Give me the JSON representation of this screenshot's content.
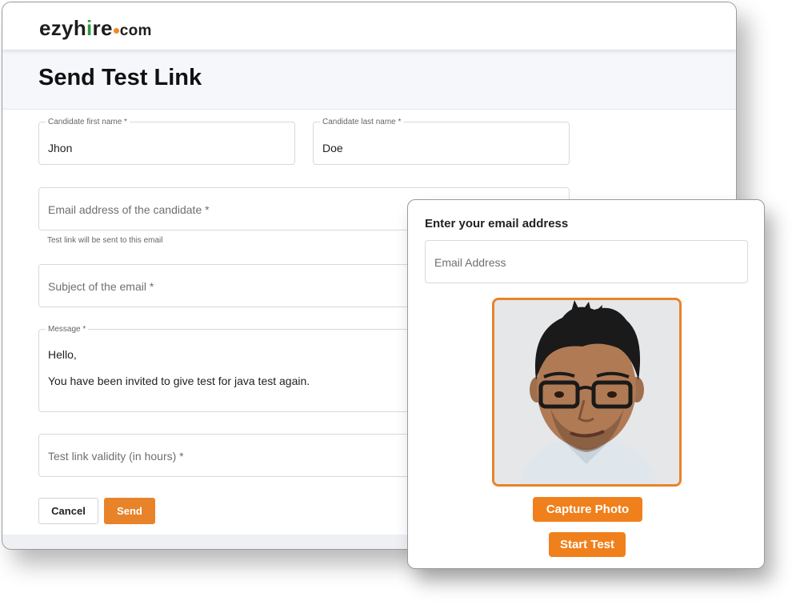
{
  "brand": {
    "name_start": "ezyh",
    "name_i": "i",
    "name_end": "re",
    "domain": "com",
    "accent": "#f08a24",
    "green": "#2e9b3c"
  },
  "page": {
    "title": "Send Test Link"
  },
  "form": {
    "first_name": {
      "label": "Candidate first name *",
      "value": "Jhon"
    },
    "last_name": {
      "label": "Candidate last name *",
      "value": "Doe"
    },
    "email": {
      "placeholder": "Email address of the candidate *",
      "helper": "Test link will be sent to this email"
    },
    "subject": {
      "placeholder": "Subject of the email *"
    },
    "message": {
      "label": "Message *",
      "line1": "Hello,",
      "line2": "You have been invited to give test for java test again."
    },
    "validity": {
      "placeholder": "Test link validity (in hours) *"
    },
    "cancel_label": "Cancel",
    "send_label": "Send",
    "send_color": "#e8832a"
  },
  "modal": {
    "title": "Enter your email address",
    "email_placeholder": "Email Address",
    "photo": "candidate-photo",
    "capture_label": "Capture Photo",
    "start_label": "Start Test",
    "button_color": "#f0801c"
  }
}
